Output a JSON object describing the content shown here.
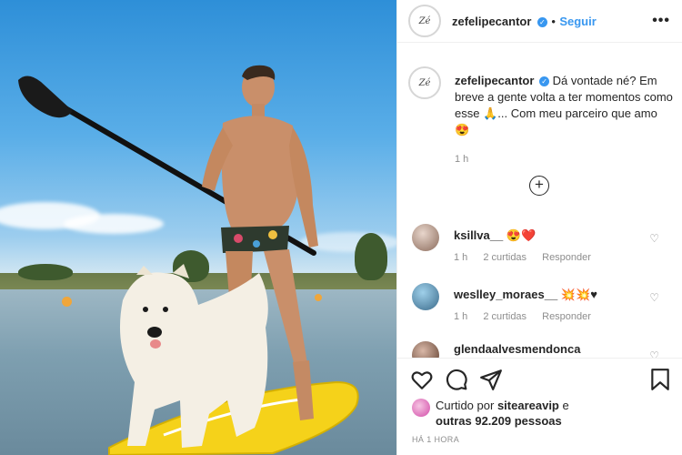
{
  "post": {
    "username": "zefelipecantor",
    "avatar_text": "Zé",
    "follow_label": "Seguir",
    "more_icon": "more-dots-icon",
    "verified_icon": "verified-check-icon"
  },
  "caption": {
    "username": "zefelipecantor",
    "text": "Dá vontade né? Em breve a gente volta a ter momentos como esse 🙏... Com meu parceiro que amo 😍",
    "time": "1 h"
  },
  "load_more_icon": "plus-circle-icon",
  "comments": [
    {
      "username": "ksillva__",
      "text": "😍❤️",
      "time": "1 h",
      "likes": "2 curtidas",
      "reply": "Responder"
    },
    {
      "username": "weslley_moraes__",
      "text": "💥💥♥",
      "time": "1 h",
      "likes": "2 curtidas",
      "reply": "Responder"
    },
    {
      "username": "glendaalvesmendonca",
      "text": "",
      "time": "",
      "likes": "",
      "reply": ""
    }
  ],
  "actions": {
    "icons": [
      "heart-icon",
      "comment-icon",
      "share-icon",
      "bookmark-icon"
    ],
    "liked_by_prefix": "Curtido por",
    "liked_by_user": "siteareavip",
    "liked_by_joiner": "e",
    "others": "outras 92.209 pessoas",
    "timestamp": "HÁ 1 HORA"
  },
  "colors": {
    "accent": "#3897f0",
    "text": "#262626",
    "muted": "#8e8e8e"
  }
}
